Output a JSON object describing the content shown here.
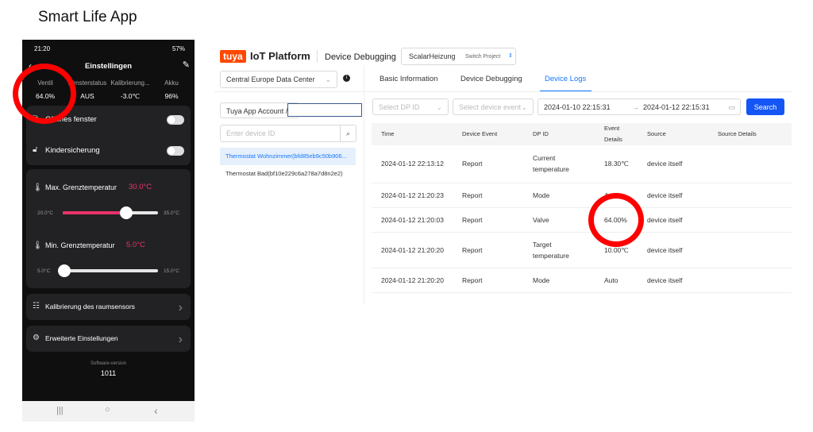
{
  "title": "Smart Life App",
  "phone": {
    "status_time": "21:20",
    "status_right": "57%",
    "header": "Einstellingen",
    "stats": [
      {
        "label": "Ventil",
        "value": "64.0%"
      },
      {
        "label": "Fensterstatus",
        "value": "AUS"
      },
      {
        "label": "Kalibrierung...",
        "value": "-3.0℃"
      },
      {
        "label": "Akku",
        "value": "96%"
      }
    ],
    "open_window": "Offenes fenster",
    "child_lock": "Kindersicherung",
    "max_temp": {
      "label": "Max. Grenztemperatur",
      "value": "30.0°C",
      "min": "20.0°C",
      "max": "35.0°C",
      "fraction": 0.67
    },
    "min_temp": {
      "label": "Min. Grenztemperatur",
      "value": "5.0°C",
      "min": "5.0°C",
      "max": "15.0°C",
      "fraction": 0
    },
    "calibration": "Kalibrierung des raumsensors",
    "advanced": "Erweiterte Einstellungen",
    "software_label": "Software-version",
    "software_value": "1011"
  },
  "platform": {
    "logo": "tuya",
    "brand": "IoT Platform",
    "section": "Device Debugging",
    "project": "ScalarHeizung",
    "switch_project": "Switch Project",
    "data_center": "Central Europe Data Center",
    "account_label": "Tuya App Account /",
    "account_value": "",
    "device_id_placeholder": "Enter device ID",
    "devices": [
      "Thermostat Wohnzimmer(bfd85eb9c50b906...",
      "Thermostat Bad(bf10e229c6a278a7d8n2e2)"
    ],
    "tabs": [
      "Basic Information",
      "Device Debugging",
      "Device Logs"
    ],
    "dp_placeholder": "Select DP ID",
    "event_placeholder": "Select device event",
    "date_from": "2024-01-10 22:15:31",
    "date_to": "2024-01-12 22:15:31",
    "arrow": "→",
    "search": "Search",
    "columns": [
      "Time",
      "Device Event",
      "DP ID",
      "Event Details",
      "Source",
      "Source Details"
    ],
    "rows": [
      [
        "2024-01-12 22:13:12",
        "Report",
        "Current temperature",
        "18.30℃",
        "device itself",
        ""
      ],
      [
        "2024-01-12 21:20:23",
        "Report",
        "Mode",
        "Auto",
        "device itself",
        ""
      ],
      [
        "2024-01-12 21:20:03",
        "Report",
        "Valve",
        "64.00%",
        "device itself",
        ""
      ],
      [
        "2024-01-12 21:20:20",
        "Report",
        "Target temperature",
        "10.00℃",
        "device itself",
        ""
      ],
      [
        "2024-01-12 21:20:20",
        "Report",
        "Mode",
        "Auto",
        "device itself",
        ""
      ]
    ]
  },
  "colors": {
    "accent": "#e8336a",
    "tuya": "#ff4800",
    "link": "#1677ff",
    "highlight": "#ff0000"
  }
}
